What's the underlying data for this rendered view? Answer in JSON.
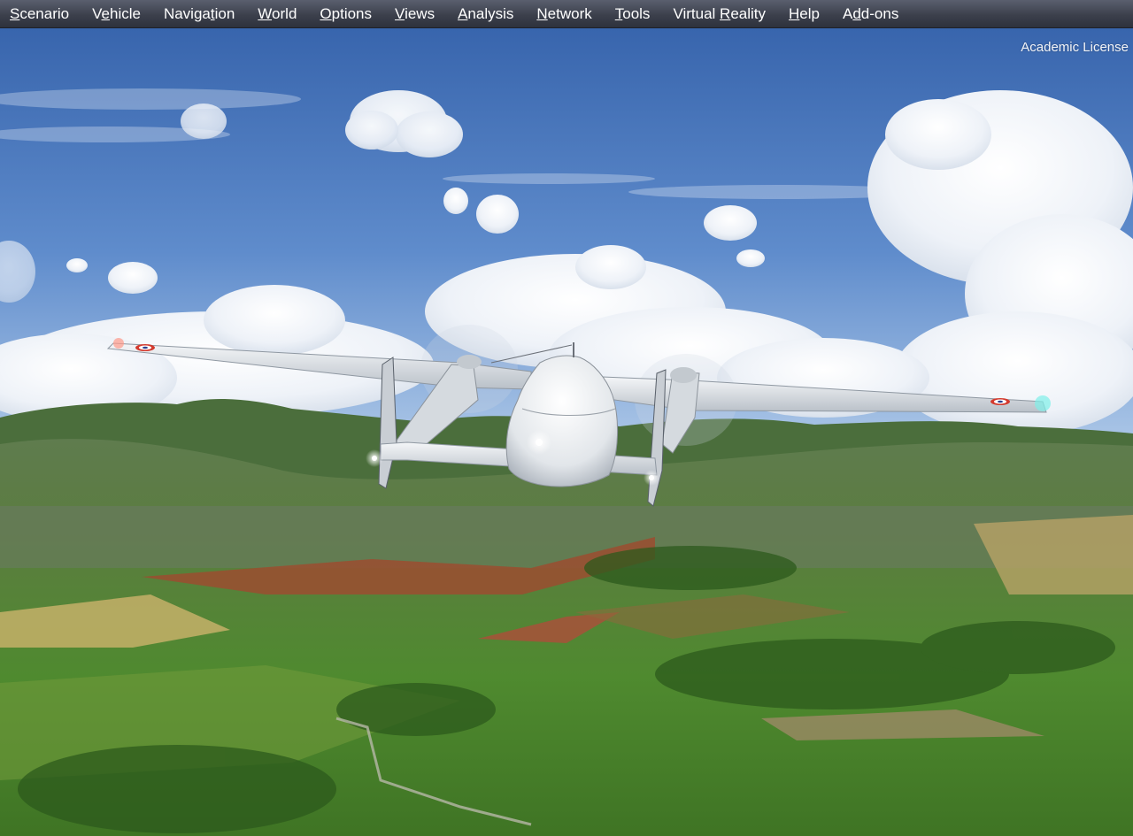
{
  "menubar": {
    "items": [
      {
        "label": "Scenario",
        "accel_index": 0
      },
      {
        "label": "Vehicle",
        "accel_index": 1
      },
      {
        "label": "Navigation",
        "accel_index": 6
      },
      {
        "label": "World",
        "accel_index": 0
      },
      {
        "label": "Options",
        "accel_index": 0
      },
      {
        "label": "Views",
        "accel_index": 0
      },
      {
        "label": "Analysis",
        "accel_index": 0
      },
      {
        "label": "Network",
        "accel_index": 0
      },
      {
        "label": "Tools",
        "accel_index": 0
      },
      {
        "label": "Virtual Reality",
        "accel_index": 8
      },
      {
        "label": "Help",
        "accel_index": 0
      },
      {
        "label": "Add-ons",
        "accel_index": 1
      }
    ]
  },
  "overlay": {
    "license_text": "Academic License"
  },
  "scene": {
    "subject": "twin-boom-transport-aircraft",
    "colors": {
      "sky_top": "#3b6db4",
      "sky_horizon": "#9fbde3",
      "terrain": "#4c7a2e",
      "fuselage": "#e8ecf0"
    }
  }
}
